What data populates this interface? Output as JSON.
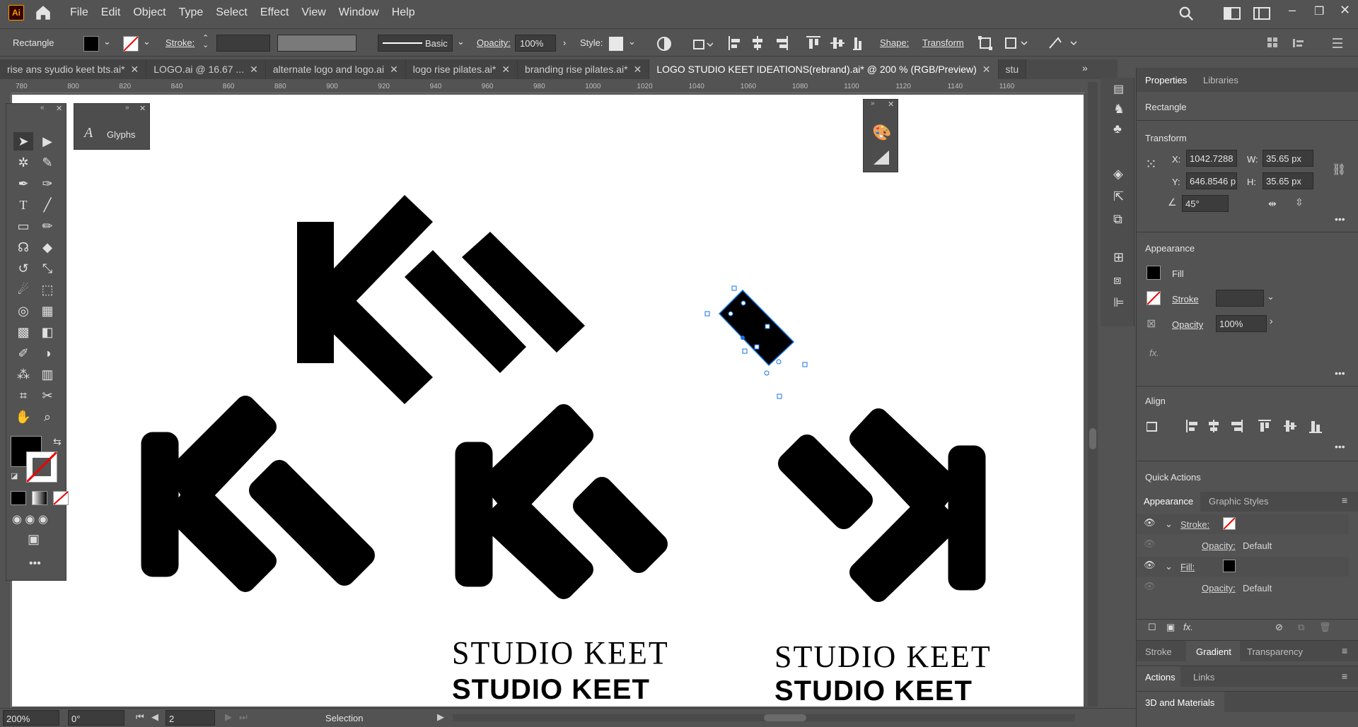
{
  "app": {
    "logo": "Ai"
  },
  "menu": [
    "File",
    "Edit",
    "Object",
    "Type",
    "Select",
    "Effect",
    "View",
    "Window",
    "Help"
  ],
  "control": {
    "selection": "Rectangle",
    "stroke_label": "Stroke:",
    "brush": "Basic",
    "opacity_label": "Opacity:",
    "opacity_value": "100%",
    "style_label": "Style:",
    "shape_label": "Shape:",
    "transform_label": "Transform"
  },
  "tabs": [
    {
      "label": "rise ans syudio keet bts.ai*"
    },
    {
      "label": "LOGO.ai @ 16.67 ..."
    },
    {
      "label": "alternate logo and logo.ai"
    },
    {
      "label": "logo rise pilates.ai*"
    },
    {
      "label": "branding rise pilates.ai*"
    },
    {
      "label": "LOGO STUDIO KEET IDEATIONS(rebrand).ai* @ 200 % (RGB/Preview)",
      "active": true
    },
    {
      "label": "stu"
    }
  ],
  "ruler_ticks": [
    "780",
    "800",
    "820",
    "840",
    "860",
    "880",
    "900",
    "920",
    "940",
    "960",
    "980",
    "1000",
    "1020",
    "1040",
    "1060",
    "1080",
    "1100",
    "1120",
    "1140",
    "1160"
  ],
  "glyphs_panel": {
    "title": "Glyphs"
  },
  "artboard": {
    "text_light_1": "STUDIO KEET",
    "text_bold_1": "STUDIO KEET",
    "text_light_2": "STUDIO KEET",
    "text_bold_2": "STUDIO KEET"
  },
  "properties": {
    "tab_properties": "Properties",
    "tab_libraries": "Libraries",
    "object_type": "Rectangle",
    "transform_title": "Transform",
    "x_label": "X:",
    "x_value": "1042.7288",
    "y_label": "Y:",
    "y_value": "646.8546 p",
    "w_label": "W:",
    "w_value": "35.65 px",
    "h_label": "H:",
    "h_value": "35.65 px",
    "angle_value": "45°",
    "appearance_title": "Appearance",
    "fill_label": "Fill",
    "stroke_label": "Stroke",
    "opacity_label": "Opacity",
    "opacity_value": "100%",
    "fx_label": "fx.",
    "align_title": "Align",
    "quick_actions": "Quick Actions"
  },
  "appearance_panel": {
    "tab_appearance": "Appearance",
    "tab_graphic_styles": "Graphic Styles",
    "rows": [
      {
        "label": "Stroke:",
        "value": ""
      },
      {
        "label": "Opacity:",
        "value": "Default"
      },
      {
        "label": "Fill:",
        "value": ""
      },
      {
        "label": "Opacity:",
        "value": "Default"
      }
    ],
    "fx": "fx."
  },
  "bottom_tabs": {
    "stroke": "Stroke",
    "gradient": "Gradient",
    "transparency": "Transparency",
    "actions": "Actions",
    "links": "Links",
    "materials": "3D and Materials"
  },
  "status": {
    "zoom": "200%",
    "rotation": "0°",
    "artboard": "2",
    "tool": "Selection"
  },
  "colors": {
    "ui_bg": "#535353",
    "canvas": "#ffffff",
    "selection": "#1473e6"
  }
}
